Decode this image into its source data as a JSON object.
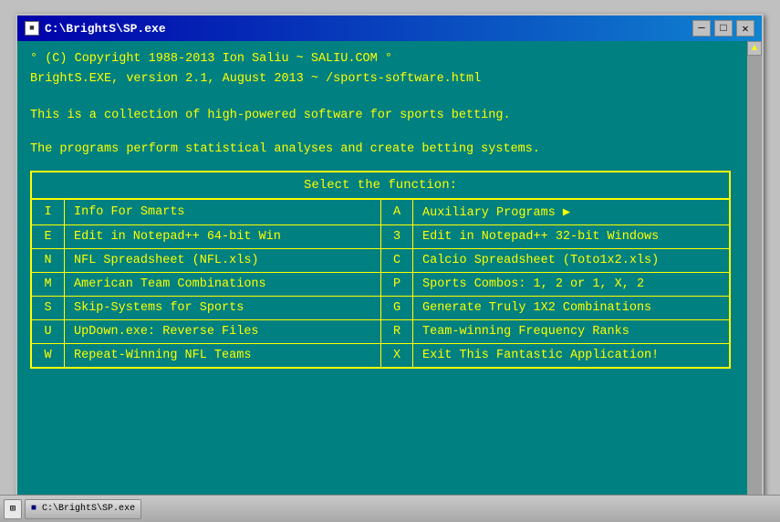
{
  "window": {
    "title": "C:\\BrightS\\SP.exe",
    "icon_label": "■"
  },
  "title_controls": {
    "minimize": "─",
    "maximize": "□",
    "close": "✕"
  },
  "console": {
    "line1": "° (C) Copyright 1988-2013 Ion Saliu ~ SALIU.COM °",
    "line2": "BrightS.EXE, version 2.1, August 2013 ~ /sports-software.html",
    "line3": "This is a collection of high-powered software for sports betting.",
    "line4": "The programs perform statistical analyses and create betting systems.",
    "menu_header": "Select the function:"
  },
  "menu_rows": [
    {
      "key1": "I",
      "label1": "Info For Smarts",
      "key2": "A",
      "label2": "Auxiliary Programs ▶"
    },
    {
      "key1": "E",
      "label1": "Edit in Notepad++ 64-bit Win",
      "key2": "3",
      "label2": "Edit in Notepad++ 32-bit Windows"
    },
    {
      "key1": "N",
      "label1": "NFL Spreadsheet (NFL.xls)",
      "key2": "C",
      "label2": "Calcio Spreadsheet (Toto1x2.xls)"
    },
    {
      "key1": "M",
      "label1": "American Team Combinations",
      "key2": "P",
      "label2": "Sports Combos:  1, 2 or 1, X, 2"
    },
    {
      "key1": "S",
      "label1": "Skip-Systems for Sports",
      "key2": "G",
      "label2": "Generate Truly 1X2 Combinations"
    },
    {
      "key1": "U",
      "label1": "UpDown.exe: Reverse Files",
      "key2": "R",
      "label2": "Team-winning Frequency Ranks"
    },
    {
      "key1": "W",
      "label1": "Repeat-Winning NFL Teams",
      "key2": "X",
      "label2": "Exit This Fantastic Application!"
    }
  ]
}
